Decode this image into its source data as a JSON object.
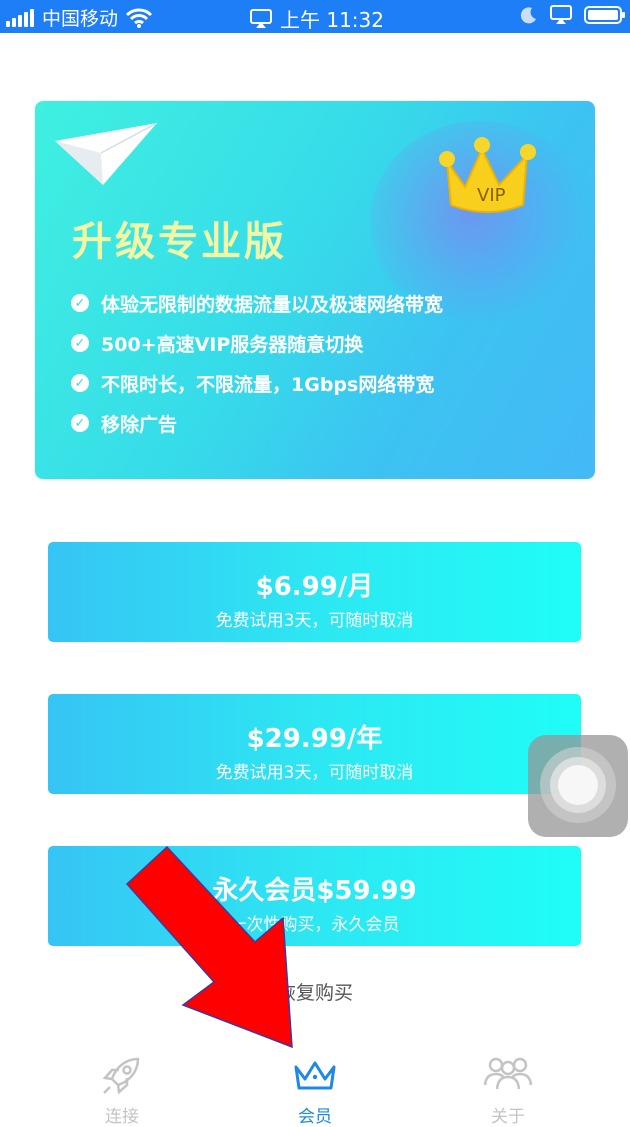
{
  "status_bar": {
    "carrier": "中国移动",
    "time": "上午 11:32"
  },
  "banner": {
    "title": "升级专业版",
    "badge": "VIP",
    "features": [
      "体验无限制的数据流量以及极速网络带宽",
      "500+高速VIP服务器随意切换",
      "不限时长，不限流量，1Gbps网络带宽",
      "移除广告"
    ]
  },
  "plans": [
    {
      "price": "$6.99/月",
      "note": "免费试用3天，可随时取消"
    },
    {
      "price": "$29.99/年",
      "note": "免费试用3天，可随时取消"
    },
    {
      "price": "永久会员$59.99",
      "note": "一次性购买，永久会员"
    }
  ],
  "restore_label": "恢复购买",
  "tabs": [
    {
      "label": "连接",
      "icon": "rocket-icon",
      "active": false
    },
    {
      "label": "会员",
      "icon": "crown-icon",
      "active": true
    },
    {
      "label": "关于",
      "icon": "people-icon",
      "active": false
    }
  ],
  "colors": {
    "status_bar": "#1e7ef5",
    "active_tab": "#1e88e5",
    "inactive_tab": "#c4c4c4",
    "annotation_arrow": "#ff0000"
  }
}
